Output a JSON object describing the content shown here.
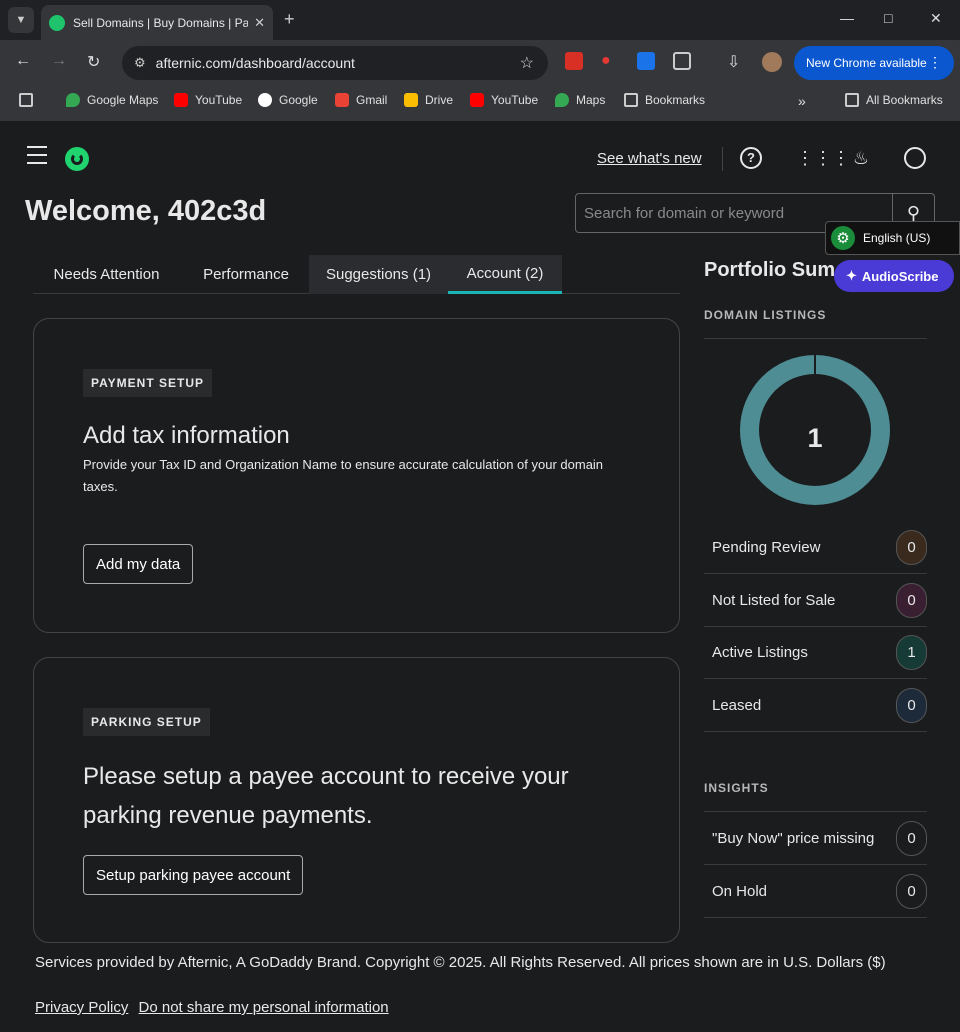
{
  "browser": {
    "tab_title": "Sell Domains | Buy Domains | Pa",
    "url": "afternic.com/dashboard/account",
    "update_label": "New Chrome available",
    "bookmarks": [
      "Google Maps",
      "YouTube",
      "Google",
      "Gmail",
      "Drive",
      "YouTube",
      "Maps",
      "Bookmarks"
    ],
    "all_bookmarks": "All Bookmarks"
  },
  "header": {
    "whats_new": "See what's new"
  },
  "welcome": "Welcome, 402c3d",
  "search": {
    "placeholder": "Search for domain or keyword"
  },
  "tabs": [
    {
      "label": "Needs Attention"
    },
    {
      "label": "Performance"
    },
    {
      "label": "Suggestions (1)"
    },
    {
      "label": "Account (2)"
    }
  ],
  "cards": [
    {
      "badge": "PAYMENT SETUP",
      "title": "Add tax information",
      "description": "Provide your Tax ID and Organization Name to ensure accurate calculation of your domain taxes.",
      "button": "Add my data"
    },
    {
      "badge": "PARKING SETUP",
      "title": "Please setup a payee account to receive your parking revenue payments.",
      "button": "Setup parking payee account"
    }
  ],
  "portfolio": {
    "title": "Portfolio Sum",
    "listings_label": "DOMAIN LISTINGS",
    "total": "1",
    "donut_color": "#4e8d93",
    "stats": [
      {
        "label": "Pending Review",
        "count": "0",
        "color": "#3a2a1e"
      },
      {
        "label": "Not Listed for Sale",
        "count": "0",
        "color": "#3a1e32"
      },
      {
        "label": "Active Listings",
        "count": "1",
        "color": "#163a36"
      },
      {
        "label": "Leased",
        "count": "0",
        "color": "#1c2a3a"
      }
    ],
    "insights_label": "INSIGHTS",
    "insights": [
      {
        "label": "\"Buy Now\" price missing",
        "count": "0"
      },
      {
        "label": "On Hold",
        "count": "0"
      }
    ]
  },
  "overlays": {
    "language": "English (US)",
    "audioscribe": "AudioScribe"
  },
  "footer": {
    "text": "Services provided by Afternic, A GoDaddy Brand. Copyright © 2025. All Rights Reserved. All prices shown are in U.S. Dollars ($)",
    "privacy": "Privacy Policy",
    "do_not_share": "Do not share my personal information"
  }
}
